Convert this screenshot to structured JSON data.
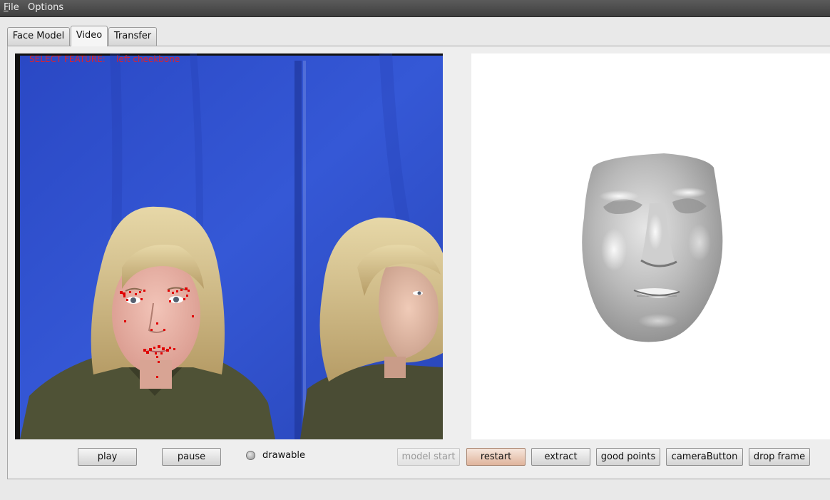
{
  "menubar": {
    "file": "File",
    "file_mnemonic": "F",
    "file_rest": "ile",
    "options": "Options"
  },
  "tabs": [
    {
      "label": "Face Model",
      "active": false
    },
    {
      "label": "Video",
      "active": true
    },
    {
      "label": "Transfer",
      "active": false
    }
  ],
  "video": {
    "overlay_label": "SELECT FEATURE:",
    "overlay_value": "left cheekbone",
    "overlay_color": "#e0222a",
    "landmark_color": "#e00000"
  },
  "controls": {
    "play": "play",
    "pause": "pause",
    "drawable": "drawable",
    "model_start": "model start",
    "restart": "restart",
    "extract": "extract",
    "good_points": "good points",
    "camera_button": "cameraButton",
    "drop_frame": "drop frame"
  },
  "colors": {
    "backdrop": "#2e4fc7",
    "menubar": "#4a4a4a",
    "panel": "#eeeeee"
  }
}
